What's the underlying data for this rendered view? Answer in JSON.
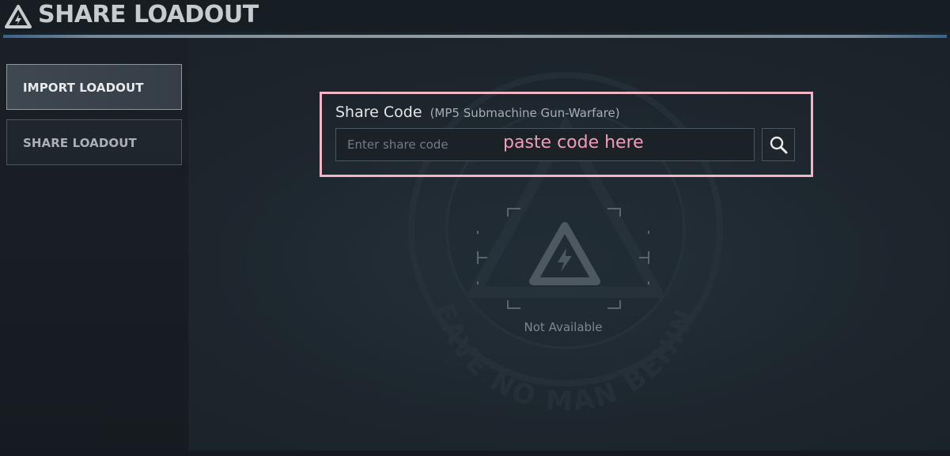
{
  "window": {
    "title": "SHARE LOADOUT",
    "accent_line_color": "#8a9dab"
  },
  "sidebar": {
    "items": [
      {
        "label": "IMPORT LOADOUT",
        "active": true
      },
      {
        "label": "SHARE LOADOUT",
        "active": false
      }
    ]
  },
  "share": {
    "label": "Share Code",
    "weapon": "(MP5 Submachine Gun-Warfare)",
    "input_value": "",
    "placeholder": "Enter share code",
    "hint": "paste code here",
    "hint_color": "#f29cbd",
    "highlight_color": "#f2b4c6",
    "search_icon": "search-icon"
  },
  "preview": {
    "status": "Not Available",
    "icon": "delta-logo-icon"
  },
  "watermark": {
    "text": "LEAVE NO MAN BEHIND"
  }
}
